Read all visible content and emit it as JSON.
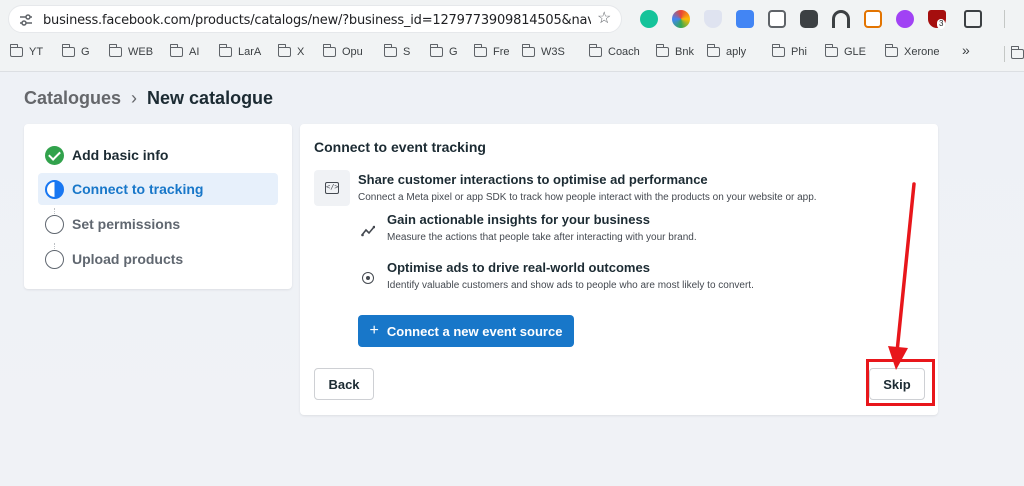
{
  "browser": {
    "url": "business.facebook.com/products/catalogs/new/?business_id=1279773909814505&nav_source...",
    "bookmarks": [
      "YT",
      "G",
      "WEB",
      "AI",
      "LarA",
      "X",
      "Opu",
      "S",
      "G",
      "Fre",
      "W3S",
      "Coach",
      "Bnk",
      "aply",
      "Phi",
      "GLE",
      "Xerone"
    ],
    "more_bookmarks": "»",
    "extension_badge": "3"
  },
  "breadcrumb": {
    "parent": "Catalogues",
    "separator": "›",
    "current": "New catalogue"
  },
  "steps": [
    {
      "label": "Add basic info",
      "state": "done"
    },
    {
      "label": "Connect to tracking",
      "state": "active"
    },
    {
      "label": "Set permissions",
      "state": "pending"
    },
    {
      "label": "Upload products",
      "state": "pending"
    }
  ],
  "card": {
    "title": "Connect to event tracking",
    "features": [
      {
        "icon": "code-icon",
        "title": "Share customer interactions to optimise ad performance",
        "desc": "Connect a Meta pixel or app SDK to track how people interact with the products on your website or app."
      },
      {
        "icon": "trend-icon",
        "title": "Gain actionable insights for your business",
        "desc": "Measure the actions that people take after interacting with your brand."
      },
      {
        "icon": "target-icon",
        "title": "Optimise ads to drive real-world outcomes",
        "desc": "Identify valuable customers and show ads to people who are most likely to convert."
      }
    ],
    "connect_button": "Connect a new event source",
    "back_button": "Back",
    "skip_button": "Skip"
  },
  "colors": {
    "accent": "#1877c9",
    "success": "#31a24c",
    "annotation": "#e8161b"
  }
}
